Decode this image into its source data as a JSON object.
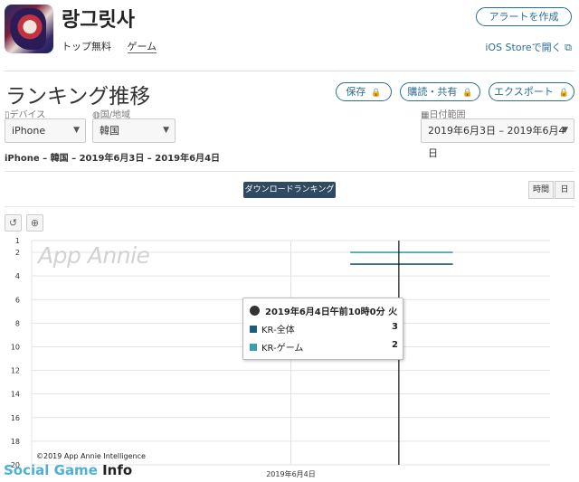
{
  "app": {
    "title": "랑그릿사",
    "tags": [
      "トップ無料",
      "ゲーム"
    ],
    "alert_button": "アラートを作成",
    "ios_link": "iOS Storeで開く"
  },
  "section": {
    "title": "ランキング推移",
    "buttons": [
      "保存",
      "購読・共有",
      "エクスポート"
    ]
  },
  "filters": {
    "device_label": "デバイス",
    "device_value": "iPhone",
    "country_label": "国/地域",
    "country_value": "韓国",
    "date_label": "日付範囲",
    "date_value": "2019年6月3日 – 2019年6月4日"
  },
  "summary": "iPhone – 韓国 – 2019年6月3日 – 2019年6月4日",
  "tabs": {
    "download_ranking": "ダウンロードランキング",
    "time": "時間",
    "day": "日"
  },
  "tooltip": {
    "title": "2019年6月4日午前10時0分 火",
    "rows": [
      {
        "label": "KR-全体",
        "value": "3",
        "color": "#1f5c7a"
      },
      {
        "label": "KR-ゲーム",
        "value": "2",
        "color": "#3aa0a8"
      }
    ]
  },
  "watermark": "App Annie",
  "copyright": "©2019 App Annie Intelligence",
  "branding": {
    "part1": "Social Game",
    "part2": " Info"
  },
  "chart_data": {
    "type": "line",
    "title": "",
    "xlabel": "",
    "ylabel": "",
    "y_ticks": [
      "1",
      "2",
      "4",
      "6",
      "8",
      "10",
      "12",
      "14",
      "16",
      "18",
      "20"
    ],
    "y_range": [
      1,
      20
    ],
    "y_inverted": true,
    "x_tick_labels": [
      "2019年6月4日"
    ],
    "x_range_hours": [
      0,
      48
    ],
    "x_tick_hours": [
      24
    ],
    "cursor_hour": 34,
    "series": [
      {
        "name": "KR-全体",
        "color": "#1f5c7a",
        "points": [
          [
            29.5,
            3
          ],
          [
            39,
            3
          ]
        ]
      },
      {
        "name": "KR-ゲーム",
        "color": "#3aa0a8",
        "points": [
          [
            29.5,
            2
          ],
          [
            39,
            2
          ]
        ]
      }
    ]
  }
}
